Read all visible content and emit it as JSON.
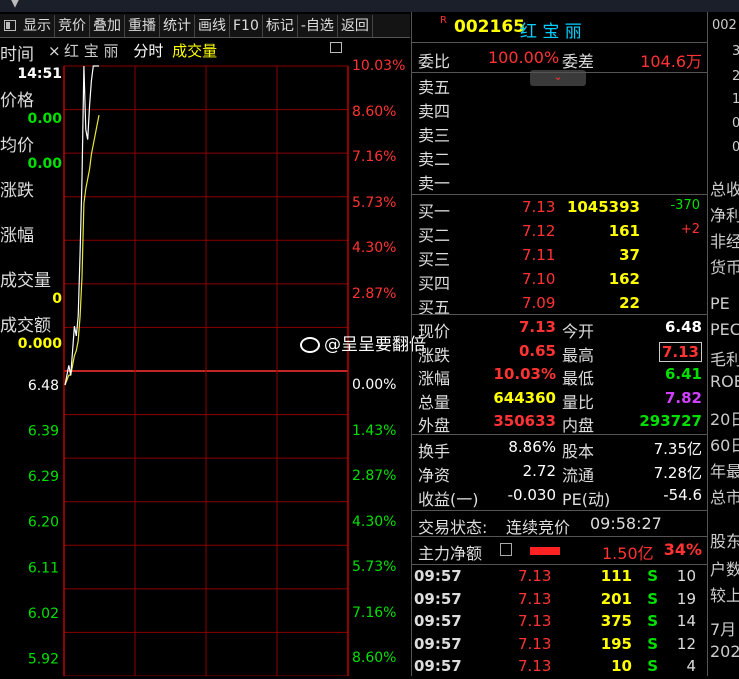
{
  "toolbar": {
    "items": [
      "显示",
      "竞价",
      "叠加",
      "重播",
      "统计",
      "画线",
      "F10",
      "标记",
      "-自选",
      "返回"
    ]
  },
  "side": {
    "time_label": "时间",
    "close_mark": "×",
    "time_value": "14:51",
    "price_label": "价格",
    "price_value": "0.00",
    "avg_label": "均价",
    "avg_value": "0.00",
    "change_label": "涨跌",
    "pct_label": "涨幅",
    "vol_label": "成交量",
    "vol_value": "0",
    "amt_label": "成交额",
    "amt_value": "0.000"
  },
  "chart_head": {
    "name": "红 宝 丽",
    "mode": "分时",
    "sub": "成交量"
  },
  "chart_data": {
    "type": "line",
    "prev_close": 6.48,
    "left_ticks": [
      "6.48",
      "6.39",
      "6.29",
      "6.20",
      "6.11",
      "6.02",
      "5.92"
    ],
    "up_pct": [
      "10.03%",
      "8.60%",
      "7.16%",
      "5.73%",
      "4.30%",
      "2.87%"
    ],
    "center_pct": "0.00%",
    "down_pct": [
      "1.43%",
      "2.87%",
      "4.30%",
      "5.73%",
      "7.16%",
      "8.60%"
    ],
    "price_series": [
      6.48,
      6.5,
      6.52,
      6.5,
      6.55,
      6.6,
      6.58,
      6.62,
      6.75,
      6.9,
      7.13,
      7.0,
      6.98,
      7.05,
      7.1,
      7.13,
      7.13,
      7.13,
      7.13
    ],
    "avg_series": [
      6.48,
      6.49,
      6.5,
      6.5,
      6.52,
      6.54,
      6.55,
      6.57,
      6.62,
      6.7,
      6.85,
      6.88,
      6.9,
      6.92,
      6.95,
      6.97,
      6.99,
      7.01,
      7.03
    ]
  },
  "stock": {
    "badge": "R",
    "code": "002165",
    "name": "红 宝 丽"
  },
  "weibi": {
    "l1": "委比",
    "v1": "100.00%",
    "l2": "委差",
    "v2": "104.6万"
  },
  "sell": [
    {
      "label": "卖五"
    },
    {
      "label": "卖四"
    },
    {
      "label": "卖三"
    },
    {
      "label": "卖二"
    },
    {
      "label": "卖一"
    }
  ],
  "buy": [
    {
      "label": "买一",
      "price": "7.13",
      "vol": "1045393",
      "chg": "-370"
    },
    {
      "label": "买二",
      "price": "7.12",
      "vol": "161",
      "chg": "+2"
    },
    {
      "label": "买三",
      "price": "7.11",
      "vol": "37",
      "chg": ""
    },
    {
      "label": "买四",
      "price": "7.10",
      "vol": "162",
      "chg": ""
    },
    {
      "label": "买五",
      "price": "7.09",
      "vol": "22",
      "chg": ""
    }
  ],
  "quote": [
    {
      "l1": "现价",
      "v1": "7.13",
      "l2": "今开",
      "v2": "6.48"
    },
    {
      "l1": "涨跌",
      "v1": "0.65",
      "l2": "最高",
      "v2": "7.13"
    },
    {
      "l1": "涨幅",
      "v1": "10.03%",
      "l2": "最低",
      "v2": "6.41"
    },
    {
      "l1": "总量",
      "v1": "644360",
      "l2": "量比",
      "v2": "7.82"
    },
    {
      "l1": "外盘",
      "v1": "350633",
      "l2": "内盘",
      "v2": "293727"
    }
  ],
  "fund": [
    {
      "l1": "换手",
      "v1": "8.86%",
      "l2": "股本",
      "v2": "7.35亿"
    },
    {
      "l1": "净资",
      "v1": "2.72",
      "l2": "流通",
      "v2": "7.28亿"
    },
    {
      "l1": "收益(一)",
      "v1": "-0.030",
      "l2": "PE(动)",
      "v2": "-54.6"
    }
  ],
  "status": {
    "label": "交易状态:",
    "value": "连续竞价",
    "time": "09:58:27"
  },
  "netflow": {
    "label": "主力净额",
    "value": "1.50亿",
    "pct": "34%"
  },
  "ticks": [
    {
      "t": "09:57",
      "p": "7.13",
      "v": "111",
      "d": "S",
      "n": "10"
    },
    {
      "t": "09:57",
      "p": "7.13",
      "v": "201",
      "d": "S",
      "n": "19"
    },
    {
      "t": "09:57",
      "p": "7.13",
      "v": "375",
      "d": "S",
      "n": "14"
    },
    {
      "t": "09:57",
      "p": "7.13",
      "v": "195",
      "d": "S",
      "n": "12"
    },
    {
      "t": "09:57",
      "p": "7.13",
      "v": "10",
      "d": "S",
      "n": "4"
    }
  ],
  "edge": [
    "002",
    "3",
    "2",
    "1",
    "0",
    "0",
    "总收",
    "净利",
    "非经",
    "货币",
    "PE",
    "PEC",
    "毛利",
    "ROE",
    "20日",
    "60日",
    "年最",
    "总市",
    "股东",
    "户数",
    "较上",
    "7月",
    "202"
  ],
  "watermark": "@呈呈要翻倍",
  "colors": {
    "up": "#ff3333",
    "down": "#00e000",
    "grid": "#8b0000",
    "yellow": "#ffff00",
    "cyan": "#00d0ff",
    "price_line": "#ffffff",
    "avg_line": "#e8e83a"
  }
}
